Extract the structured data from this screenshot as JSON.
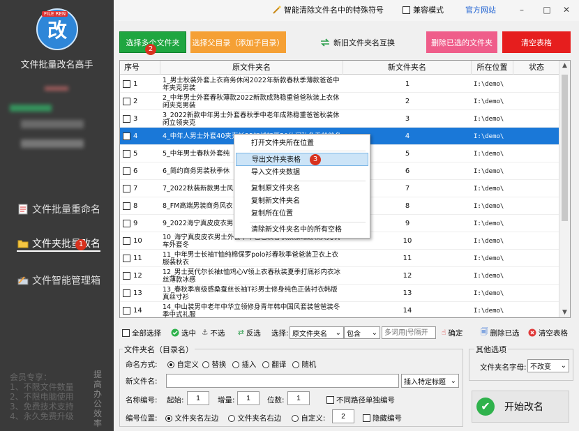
{
  "app": {
    "logo_tag": "FILE REN",
    "logo_char": "改",
    "name": "文件批量改名高手"
  },
  "sidebar": {
    "items": [
      {
        "label": "文件批量重命名",
        "icon": "document-icon"
      },
      {
        "label": "文件夹批量改名",
        "icon": "folder-icon",
        "badge": "1"
      },
      {
        "label": "文件智能管理箱",
        "icon": "toolbox-icon"
      }
    ],
    "member_lines": [
      "会员专享：",
      "1、不限文件数量",
      "2、不限电脑使用",
      "3、免费技术支持",
      "4、永久免费升级"
    ],
    "slogan": "提高办公效率"
  },
  "topbar": {
    "special_chars": "智能清除文件名中的特殊符号",
    "compat_mode": "兼容模式",
    "official_site": "官方网站",
    "minimize": "–",
    "maximize": "□",
    "close": "✕"
  },
  "toolbar": {
    "select_multi": "选择多个文件夹",
    "select_multi_badge": "2",
    "select_parent": "选择父目录（添加子目录）",
    "swap": "新旧文件夹名互换",
    "delete_selected": "删除已选的文件夹",
    "clear_table": "清空表格"
  },
  "table": {
    "headers": [
      "序号",
      "原文件夹名",
      "新文件夹名",
      "所在位置",
      "状态"
    ],
    "rows": [
      {
        "no": "1",
        "orig": "1_男士秋装外套上衣商务休闲2022年新款春秋季薄款爸爸中年夹克男装",
        "new": "1",
        "pos": "I:\\demo\\"
      },
      {
        "no": "2",
        "orig": "2_中年男士外套春秋薄款2022新款成熟稳重爸爸秋装上衣休闲夹克男装",
        "new": "2",
        "pos": "I:\\demo\\"
      },
      {
        "no": "3",
        "orig": "3_2022新款中年男士外套春秋季中老年成熟稳重爸爸秋装休闲立领夹克",
        "new": "3",
        "pos": "I:\\demo\\"
      },
      {
        "no": "4",
        "orig": "4_中年人男士外套40夹克衫35加绒加厚50休闲秋冬季爸爸冬",
        "new": "4",
        "pos": "I:\\demo\\"
      },
      {
        "no": "5",
        "orig": "5_中年男士春秋外套纯",
        "new": "5",
        "pos": "I:\\demo\\"
      },
      {
        "no": "6",
        "orig": "6_简约商务男装秋季休",
        "new": "6",
        "pos": "I:\\demo\\"
      },
      {
        "no": "7",
        "orig": "7_2022秋装新款男士风",
        "new": "7",
        "pos": "I:\\demo\\"
      },
      {
        "no": "8",
        "orig": "8_FM高端男装商务风衣",
        "new": "8",
        "pos": "I:\\demo\\"
      },
      {
        "no": "9",
        "orig": "9_2022海宁真皮皮衣男",
        "new": "9",
        "pos": "I:\\demo\\"
      },
      {
        "no": "10",
        "orig": "10_海宁真皮皮衣男士外套中年爸爸装春秋款加绒翻领夹克机车外套冬",
        "new": "10",
        "pos": "I:\\demo\\"
      },
      {
        "no": "11",
        "orig": "11_中年男士长袖T恤纯棉保罗polo衫春秋季爸爸装卫衣上衣服装秋衣",
        "new": "11",
        "pos": "I:\\demo\\"
      },
      {
        "no": "12",
        "orig": "12_男士莫代尔长袖t恤鸡心V领上衣春秋装夏季打底衫内衣冰丝薄款冰感",
        "new": "12",
        "pos": "I:\\demo\\"
      },
      {
        "no": "13",
        "orig": "13_春秋季高级感桑蚕丝长袖T衫男士修身纯色正装衬衣韩版真丝寸衫",
        "new": "13",
        "pos": "I:\\demo\\"
      },
      {
        "no": "14",
        "orig": "14_中山装男中老年中华立领修身青年韩中国风套装爸爸装冬季中式礼服",
        "new": "14",
        "pos": "I:\\demo\\"
      }
    ]
  },
  "context_menu": {
    "items": [
      "打开文件夹所在位置",
      "导出文件夹表格",
      "导入文件夹数据",
      "复制原文件夹名",
      "复制新文件夹名",
      "复制所在位置",
      "清除新文件夹名中的所有空格"
    ],
    "hover_badge": "3"
  },
  "filterbar": {
    "select_all": "全部选择",
    "select_in": "选中",
    "unselect": "不选",
    "invert": "反选",
    "select_label": "选择:",
    "field": "原文件夹名",
    "match": "包含",
    "keyword_placeholder": "多词用|号隔开",
    "confirm": "确定",
    "delete_selected": "删除已选",
    "clear_table": "清空表格"
  },
  "form": {
    "group_title": "文件夹名（目录名）",
    "naming_label": "命名方式:",
    "naming_options": [
      "自定义",
      "替换",
      "插入",
      "翻译",
      "随机"
    ],
    "new_name_label": "新文件名:",
    "new_name_value": "",
    "insert_title": "插入特定标题",
    "seq_label": "名称编号:",
    "start_label": "起始:",
    "start_value": "1",
    "inc_label": "增量:",
    "inc_value": "1",
    "digits_label": "位数:",
    "digits_value": "1",
    "separate_path": "不同路径单独编号",
    "seq_pos_label": "编号位置:",
    "pos_left": "文件夹名左边",
    "pos_right": "文件夹名右边",
    "pos_custom": "自定义:",
    "pos_custom_value": "2",
    "hide_seq": "隐藏编号"
  },
  "other": {
    "group_title": "其他选项",
    "case_label": "文件夹名字母:",
    "case_value": "不改变"
  },
  "start_button": "开始改名",
  "colors": {
    "selected_row": "#1a78d8",
    "badge": "#d8321e",
    "green": "#1fa640"
  }
}
